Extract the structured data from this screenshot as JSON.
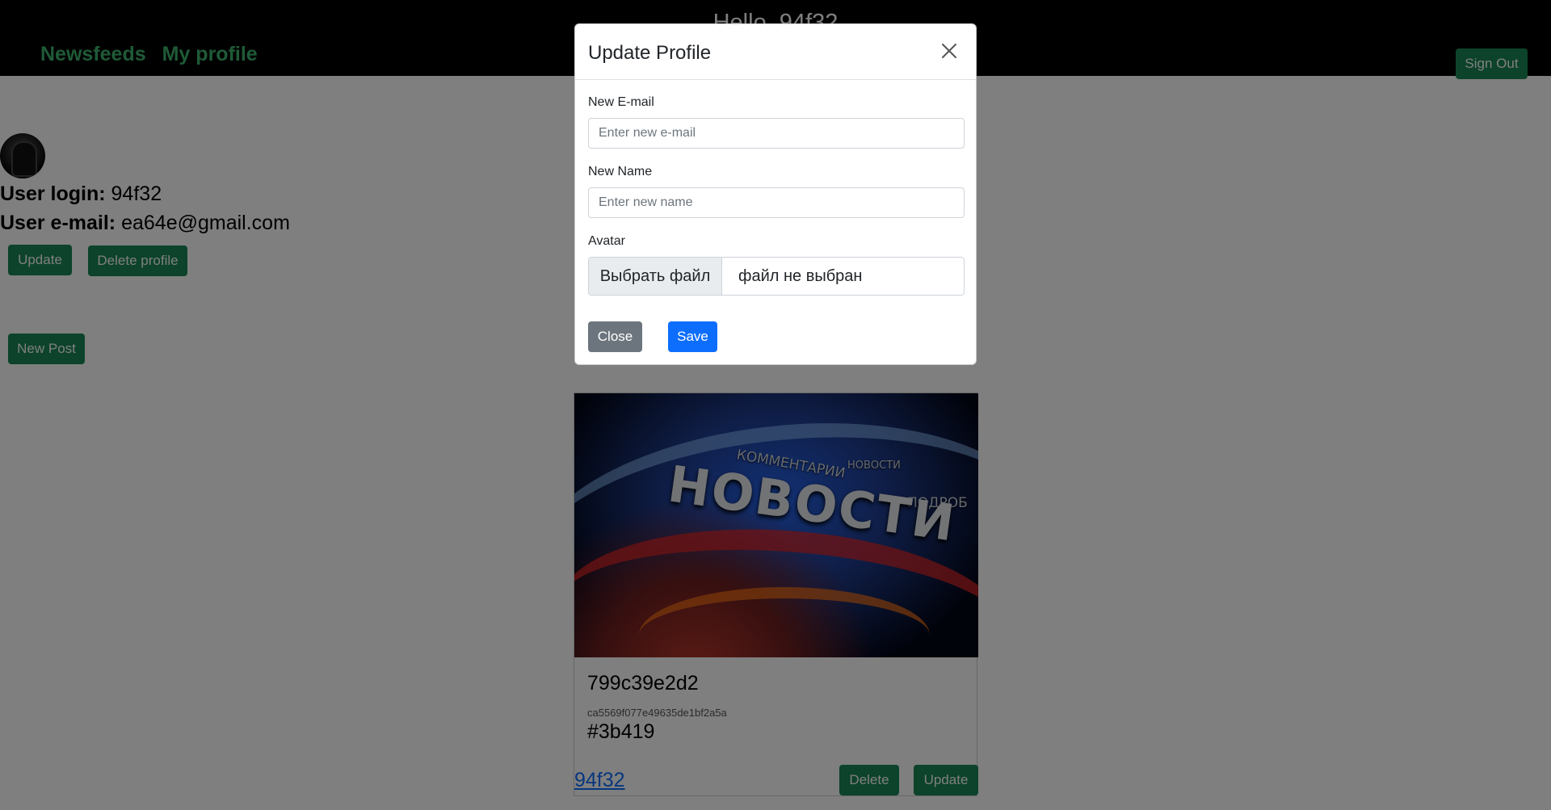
{
  "header": {
    "greeting": "Hello, 94f32",
    "nav": [
      {
        "label": "Newsfeeds"
      },
      {
        "label": "My profile"
      }
    ],
    "sign_out_label": "Sign Out"
  },
  "profile": {
    "login_label": "User login:",
    "login_value": "94f32",
    "email_label": "User e-mail:",
    "email_value": "ea64e@gmail.com",
    "update_label": "Update",
    "delete_label": "Delete profile",
    "new_post_label": "New Post"
  },
  "post": {
    "image_text": "НОВОСТИ",
    "image_small_1": "КОММЕНТАРИИ",
    "image_small_2": "НОВОСТИ",
    "image_small_3": "ПОДРОБ",
    "title": "799c39e2d2",
    "hash": "ca5569f077e49635de1bf2a5a",
    "tag": "#3b419",
    "author": "94f32",
    "delete_label": "Delete",
    "update_label": "Update"
  },
  "modal": {
    "title": "Update Profile",
    "email_label": "New E-mail",
    "email_placeholder": "Enter new e-mail",
    "email_value": "",
    "name_label": "New Name",
    "name_placeholder": "Enter new name",
    "name_value": "",
    "avatar_label": "Avatar",
    "file_button_label": "Выбрать файл",
    "file_status": "файл не выбран",
    "close_label": "Close",
    "save_label": "Save"
  },
  "colors": {
    "nav_link": "#3fb56f",
    "success": "#198754",
    "primary": "#0d6efd",
    "secondary": "#6c757d"
  }
}
